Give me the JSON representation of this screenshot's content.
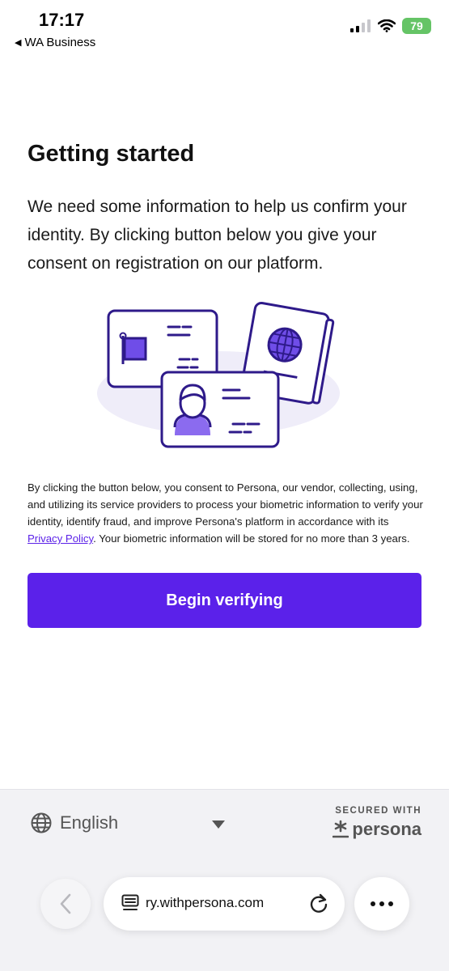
{
  "status_bar": {
    "time": "17:17",
    "back_app_label": "WA Business",
    "battery_level": "79"
  },
  "main": {
    "title": "Getting started",
    "intro": "We need some information to help us confirm your identity. By clicking button below you give your consent on registration on our platform.",
    "consent_before_link": "By clicking the button below, you consent to Persona, our vendor, collecting, using, and utilizing its service providers to process your biometric information to verify your identity, identify fraud, and improve Persona's platform in accordance with its ",
    "consent_link": "Privacy Policy",
    "consent_after_link": ". Your biometric information will be stored for no more than 3 years.",
    "cta_label": "Begin verifying"
  },
  "footer": {
    "language": "English",
    "secured_label": "SECURED WITH",
    "brand_name": "persona"
  },
  "browser": {
    "url": "ry.withpersona.com"
  },
  "colors": {
    "accent": "#5b21ea",
    "illustration_stroke": "#2e1a8a",
    "illustration_bg": "#efedf9"
  },
  "icons": [
    "back-triangle-icon",
    "signal-icon",
    "wifi-icon",
    "battery-icon",
    "globe-icon",
    "chevron-down-icon",
    "persona-asterisk-icon",
    "back-arrow-icon",
    "reader-icon",
    "reload-icon",
    "more-icon"
  ]
}
